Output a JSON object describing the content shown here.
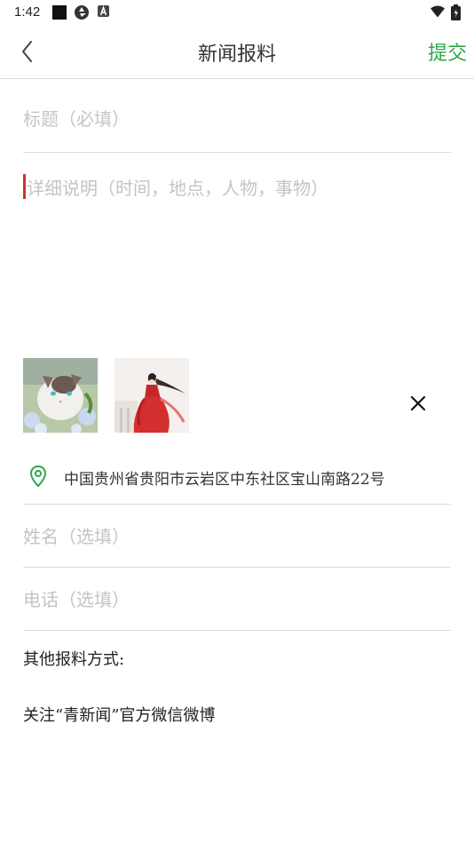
{
  "status_bar": {
    "time": "1:42",
    "left_icons": [
      "square-icon",
      "aperture-icon",
      "a-box-icon"
    ],
    "right_icons": [
      "wifi-icon",
      "battery-icon"
    ]
  },
  "header": {
    "back_icon": "chevron-left-icon",
    "title": "新闻报料",
    "submit_label": "提交",
    "accent_color": "#2ea84a"
  },
  "form": {
    "title_placeholder": "标题（必填）",
    "detail_placeholder": "详细说明（时间，地点，人物，事物）",
    "images": [
      {
        "name": "cat-photo"
      },
      {
        "name": "red-dress-photo"
      }
    ],
    "remove_icon": "close-icon",
    "location": {
      "icon": "map-pin-icon",
      "text": "中国贵州省贵阳市云岩区中东社区宝山南路22号"
    },
    "name_placeholder": "姓名（选填）",
    "phone_placeholder": "电话（选填）"
  },
  "other": {
    "heading": "其他报料方式:",
    "text": "关注“青新闻”官方微信微博"
  }
}
